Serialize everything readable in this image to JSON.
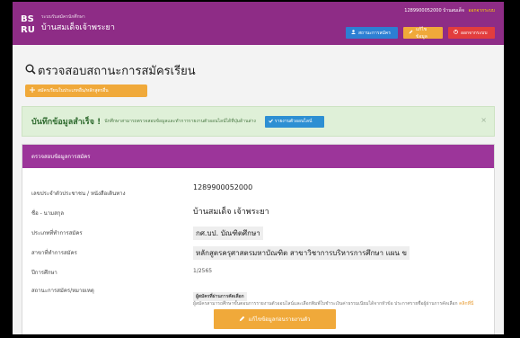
{
  "header": {
    "logo_mark": "BS\nRU",
    "site_small": "ระบบรับสมัครนักศึกษา",
    "site_title": "บ้านสมเด็จเจ้าพระยา",
    "user_line": "1289900052000 บ้านสมเด็จ",
    "logout_label": "ออกจากระบบ",
    "nav": [
      {
        "label": "สถานะการสมัคร",
        "icon": "user-icon",
        "color": "#2d7fd3"
      },
      {
        "label": "แก้ไขข้อมูล",
        "icon": "pencil-icon",
        "color": "#f0a93a"
      },
      {
        "label": "ออกจากระบบ",
        "icon": "power-icon",
        "color": "#e23d3d"
      }
    ]
  },
  "page": {
    "title": "ตรวจสอบสถานะการสมัครเรียน",
    "register_button": "สมัครเรียนในประเภทอื่น/หลักสูตรอื่น",
    "alert": {
      "strong": "บันทึกข้อมูลสำเร็จ !",
      "message": "นักศึกษาสามารถตรวจสอบข้อมูลและทำการรายงานตัวออนไลน์ได้ที่ปุ่มด้านล่าง",
      "button": "รายงานตัวออนไลน์",
      "close": "×"
    },
    "panel_title": "ตรวจสอบข้อมูลการสมัคร",
    "rows": [
      {
        "label": "เลขประจำตัวประชาชน / หนังสือเดินทาง",
        "value": "1289900052000"
      },
      {
        "label": "ชื่อ - นามสกุล",
        "value": "บ้านสมเด็จ เจ้าพระยา"
      },
      {
        "label": "ประเภทที่ทำการสมัคร",
        "value": "กศ.บป. บัณฑิตศึกษา"
      },
      {
        "label": "สาขาที่ทำการสมัคร",
        "value": "หลักสูตรครุศาสตรมหาบัณฑิต สาขาวิชาการบริหารการศึกษา แผน ข"
      },
      {
        "label": "ปีการศึกษา",
        "value": "1/2565"
      },
      {
        "label": "สถานะการสมัคร/หมายเหตุ",
        "value": "ผู้สมัครที่ผ่านการคัดเลือก"
      }
    ],
    "status_desc": "ผู้สมัครสามารถศึกษาขั้นตอนการรายงานตัวออนไลน์และเลือกพิมพ์ใบชำระเงินค่าธรรมเนียมได้จากหัวข้อ ประกาศรายชื่อผู้ผ่านการคัดเลือก",
    "status_link": "คลิกที่นี่",
    "edit_button": "แก้ไขข้อมูลก่อนรายงานตัว"
  }
}
